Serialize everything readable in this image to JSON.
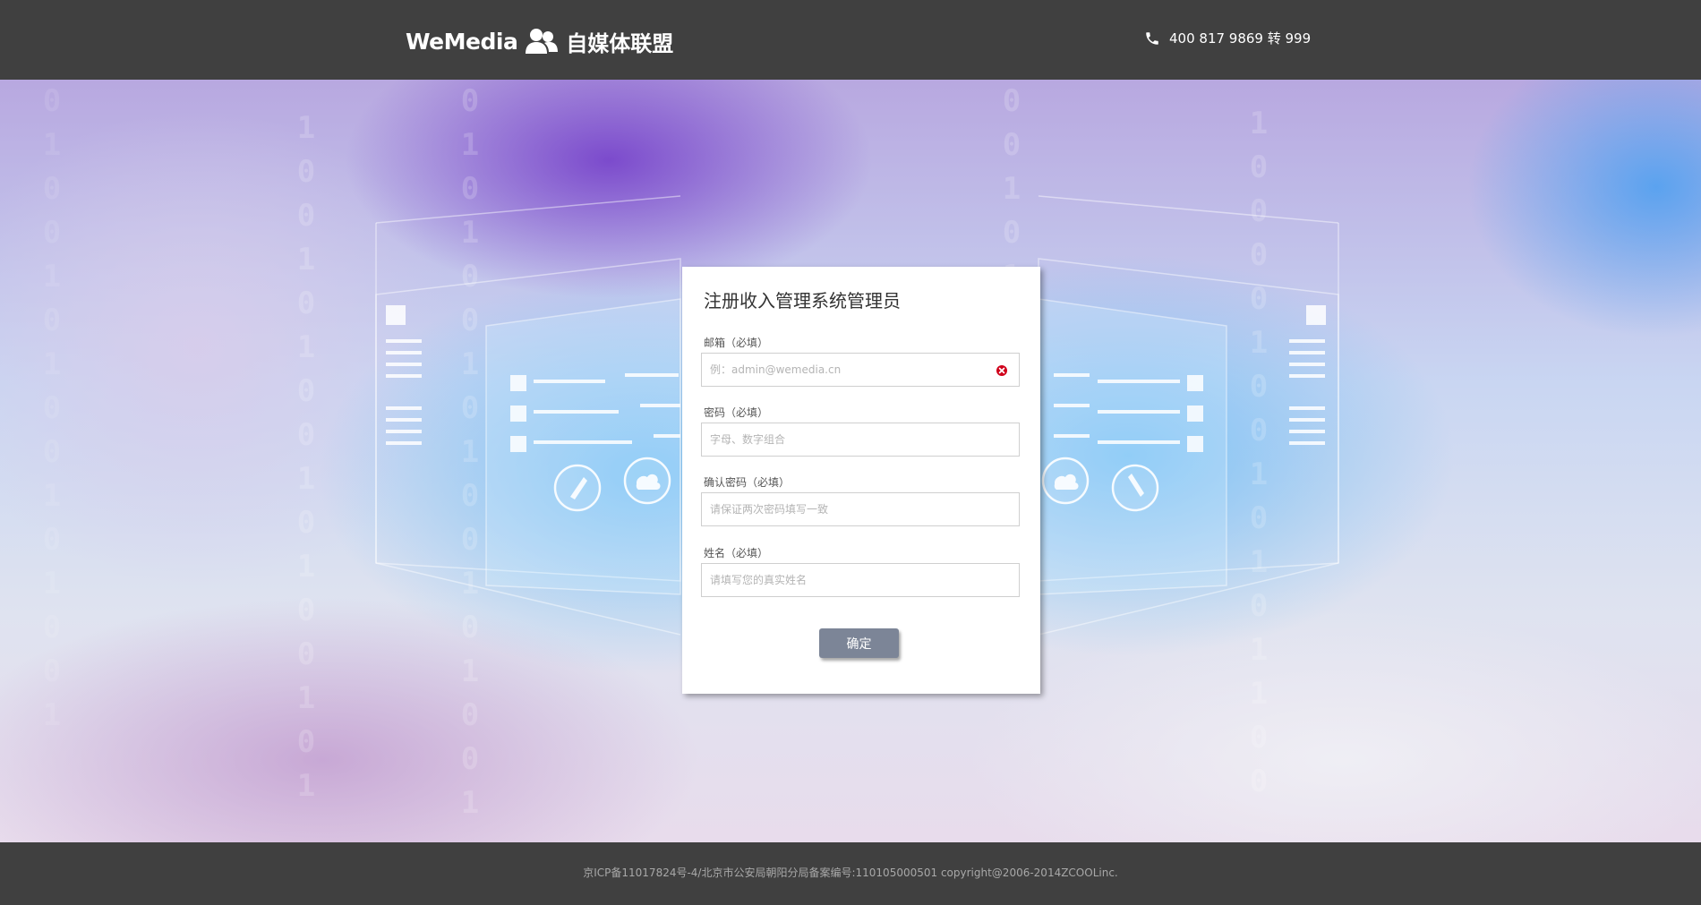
{
  "header": {
    "logo_text": "WeMedia",
    "logo_cn": "自媒体联盟",
    "logo_icon": "users-icon",
    "phone_icon": "phone-icon",
    "phone": "400 817 9869 转 999"
  },
  "form": {
    "title": "注册收入管理系统管理员",
    "fields": [
      {
        "label": "邮箱（必填）",
        "placeholder": "例：admin@wemedia.cn",
        "value": ""
      },
      {
        "label": "密码（必填）",
        "placeholder": "字母、数字组合",
        "value": ""
      },
      {
        "label": "确认密码（必填）",
        "placeholder": "请保证两次密码填写一致",
        "value": ""
      },
      {
        "label": "姓名（必填）",
        "placeholder": "请填写您的真实姓名",
        "value": ""
      }
    ],
    "clear_icon": "close-circle-icon",
    "submit_label": "确定"
  },
  "footer": {
    "text": "京ICP备11017824号-4/北京市公安局朝阳分局备案编号:110105000501  copyright@2006-2014ZCOOLinc."
  },
  "colors": {
    "header_bg": "#404040",
    "button": "#7c8597",
    "error_icon": "#d0021b"
  }
}
